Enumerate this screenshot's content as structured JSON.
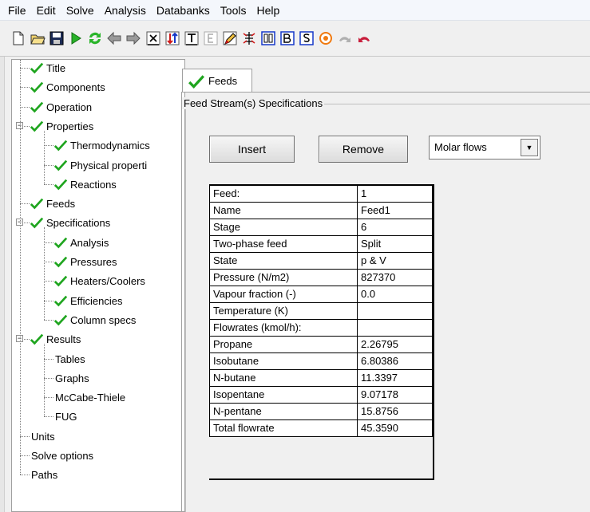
{
  "menu": [
    "File",
    "Edit",
    "Solve",
    "Analysis",
    "Databanks",
    "Tools",
    "Help"
  ],
  "toolbar": {
    "icons": [
      "new-file-icon",
      "open-folder-icon",
      "save-icon",
      "run-icon",
      "refresh-icon",
      "back-arrow-icon",
      "forward-arrow-icon",
      "x-box-icon",
      "sort-arrows-icon",
      "t-box-icon",
      "e-box-icon",
      "edit-pencil-icon",
      "flowsheet-icon",
      "b0-box-icon",
      "b-box-icon",
      "s-box-icon",
      "target-icon",
      "undo-gray-icon",
      "undo-red-icon"
    ]
  },
  "tree": {
    "items": [
      {
        "label": "Title",
        "checked": true
      },
      {
        "label": "Components",
        "checked": true
      },
      {
        "label": "Operation",
        "checked": true
      },
      {
        "label": "Properties",
        "checked": true
      },
      {
        "label": "Thermodynamics",
        "checked": true
      },
      {
        "label": "Physical properti",
        "checked": true
      },
      {
        "label": "Reactions",
        "checked": true
      },
      {
        "label": "Feeds",
        "checked": true
      },
      {
        "label": "Specifications",
        "checked": true
      },
      {
        "label": "Analysis",
        "checked": true
      },
      {
        "label": "Pressures",
        "checked": true
      },
      {
        "label": "Heaters/Coolers",
        "checked": true
      },
      {
        "label": "Efficiencies",
        "checked": true
      },
      {
        "label": "Column specs",
        "checked": true
      },
      {
        "label": "Results",
        "checked": true
      },
      {
        "label": "Tables",
        "checked": false
      },
      {
        "label": "Graphs",
        "checked": false
      },
      {
        "label": "McCabe-Thiele",
        "checked": false
      },
      {
        "label": "FUG",
        "checked": false
      },
      {
        "label": "Units",
        "checked": false
      },
      {
        "label": "Solve options",
        "checked": false
      },
      {
        "label": "Paths",
        "checked": false
      }
    ]
  },
  "tab": {
    "label": "Feeds"
  },
  "group": {
    "title": "Feed Stream(s) Specifications"
  },
  "buttons": {
    "insert": "Insert",
    "remove": "Remove"
  },
  "select": {
    "value": "Molar flows"
  },
  "grid": {
    "rows": [
      [
        "Feed:",
        "1"
      ],
      [
        "Name",
        "Feed1"
      ],
      [
        "Stage",
        "6"
      ],
      [
        "Two-phase feed",
        "Split"
      ],
      [
        "State",
        "p & V"
      ],
      [
        "Pressure (N/m2)",
        "827370"
      ],
      [
        "Vapour fraction (-)",
        "0.0"
      ],
      [
        "Temperature (K)",
        ""
      ],
      [
        "Flowrates (kmol/h):",
        ""
      ],
      [
        "Propane",
        "2.26795"
      ],
      [
        "Isobutane",
        "6.80386"
      ],
      [
        "N-butane",
        "11.3397"
      ],
      [
        "Isopentane",
        "9.07178"
      ],
      [
        "N-pentane",
        "15.8756"
      ],
      [
        "Total flowrate",
        "45.3590"
      ]
    ]
  },
  "colors": {
    "check": "#1fa51f",
    "accent": "#0b56c4"
  }
}
